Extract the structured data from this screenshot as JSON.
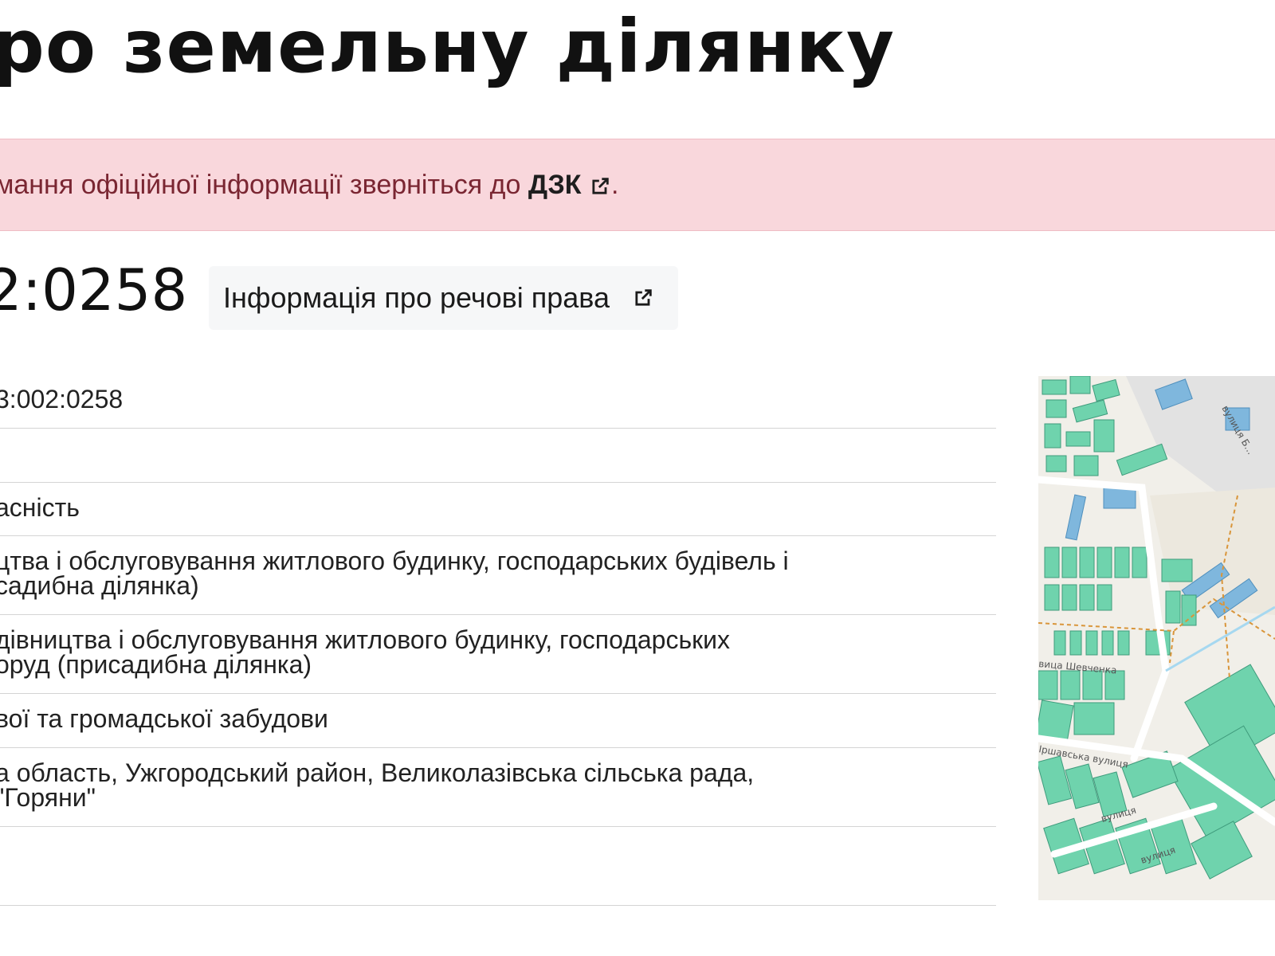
{
  "page": {
    "title": "ро земельну ділянку"
  },
  "alert": {
    "text_before": "мання офіційної інформації зверніться до ",
    "link_label": "ДЗК",
    "text_after": "."
  },
  "parcel": {
    "number": "2:0258",
    "rights_button_label": "Інформація про речові права"
  },
  "info_rows": [
    "3:002:0258",
    "",
    "асність",
    "цтва і обслуговування житлового будинку, господарських будівель і\nсадибна ділянка)",
    "дівництва і обслуговування житлового будинку, господарських\nоруд (присадибна ділянка)",
    "вої та громадської забудови",
    "а область, Ужгородський район, Великолазівська сільська рада,\n\"Горяни\"",
    ""
  ],
  "map": {
    "street_labels": [
      "вулиця Б...",
      "вица Шевченка",
      "Іршавська вулиця",
      "вулиця",
      "вулиця"
    ]
  },
  "colors": {
    "alert_bg": "#f9d7dc",
    "alert_text": "#7a2632",
    "parcel_green": "#6fd3ad",
    "parcel_blue": "#7fb7dd",
    "boundary_orange": "#d9953a"
  },
  "icons": [
    "external-link-icon"
  ]
}
